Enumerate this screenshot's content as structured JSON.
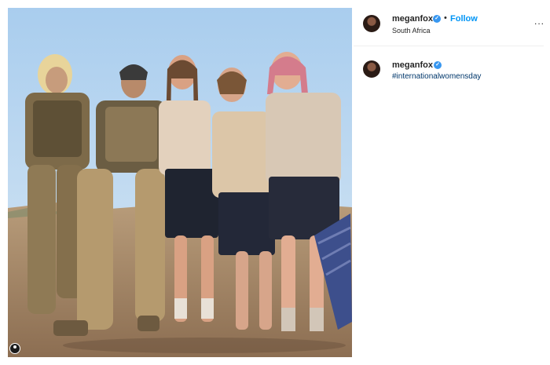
{
  "post": {
    "username": "meganfox",
    "location": "South Africa",
    "follow_label": "Follow",
    "bullet": "•",
    "more_label": "...",
    "verified_glyph": "✓",
    "caption_username": "meganfox",
    "caption_hashtag": "#internationalwomensday"
  },
  "colors": {
    "follow_blue": "#0095f6",
    "verified_blue": "#3897f0",
    "hashtag": "#00376b",
    "text": "#262626"
  },
  "icons": [
    "verified-badge-icon",
    "more-options-icon",
    "user-tag-icon"
  ]
}
